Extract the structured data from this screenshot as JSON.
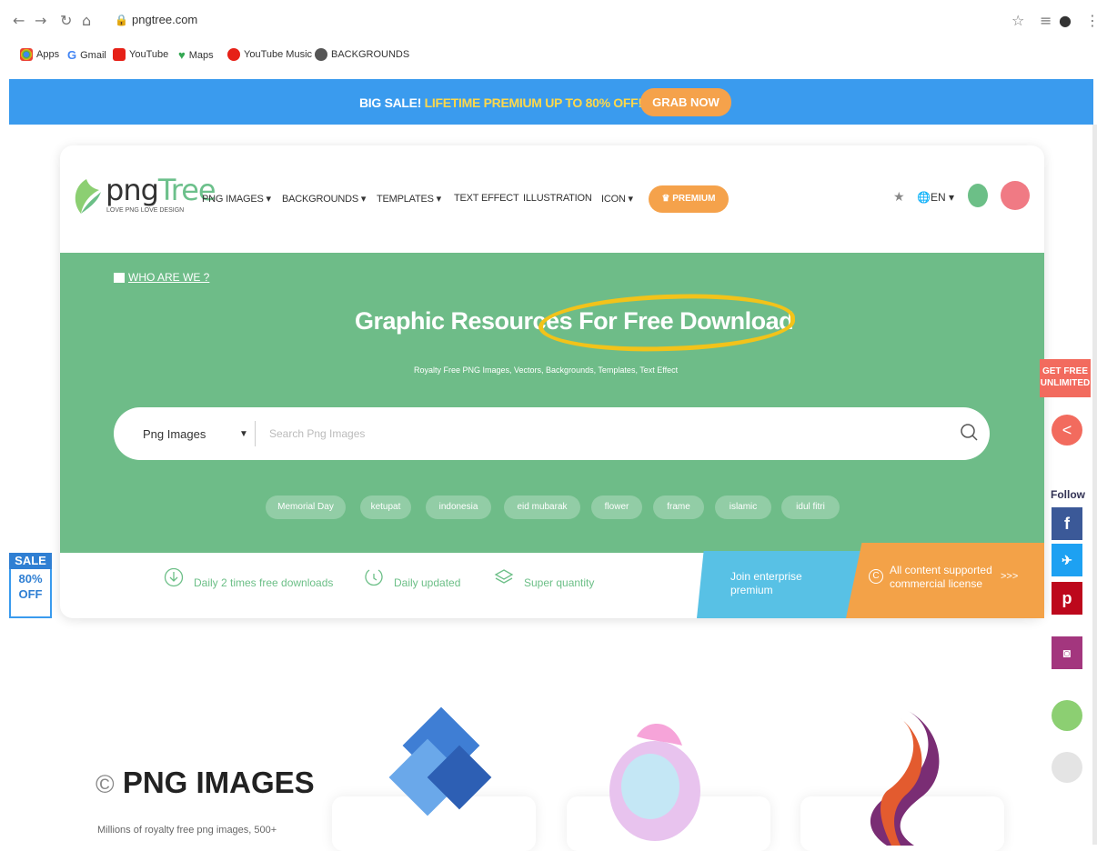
{
  "browser": {
    "url": "pngtree.com",
    "bookmarks": [
      "Apps",
      "Gmail",
      "YouTube",
      "Maps",
      "YouTube Music",
      "BACKGROUNDS"
    ]
  },
  "promo": {
    "text_white": "BIG SALE! ",
    "text_yellow": "LIFETIME PREMIUM UP TO 80% OFF!",
    "button": "GRAB NOW"
  },
  "header": {
    "logo_left": "png",
    "logo_right": "Tree",
    "tagline": "LOVE PNG LOVE DESIGN",
    "nav": [
      "PNG IMAGES ▾",
      "BACKGROUNDS ▾",
      "TEMPLATES ▾",
      "TEXT EFFECT",
      "ILLUSTRATION",
      "ICON ▾"
    ],
    "premium": "PREMIUM",
    "language": "EN ▾"
  },
  "hero": {
    "who": "WHO ARE WE ?",
    "headline": "Graphic Resources For Free Download",
    "subtitle": "Royalty Free PNG Images, Vectors, Backgrounds, Templates, Text Effect",
    "search_type": "Png Images",
    "search_placeholder": "Search Png Images",
    "tags": [
      "Memorial Day",
      "ketupat",
      "indonesia",
      "eid mubarak",
      "flower",
      "frame",
      "islamic",
      "idul fitri"
    ]
  },
  "features": {
    "daily_downloads": "Daily 2 times free downloads",
    "daily_updated": "Daily updated",
    "super_quantity": "Super quantity",
    "enterprise": "Join enterprise premium",
    "license": "All content supported commercial license"
  },
  "sale_badge": {
    "line1": "SALE",
    "line2": "80%",
    "line3": "OFF"
  },
  "sidebar": {
    "get_free": "GET FREE UNLIMITED",
    "follow": "Follow",
    "social": [
      {
        "name": "facebook",
        "glyph": "f",
        "color": "#3b5998"
      },
      {
        "name": "twitter",
        "glyph": "🐦",
        "color": "#1da1f2"
      },
      {
        "name": "pinterest",
        "glyph": "P",
        "color": "#bd081c"
      },
      {
        "name": "instagram",
        "glyph": "◙",
        "color": "#8a3ab9"
      }
    ]
  },
  "section": {
    "title": "PNG IMAGES",
    "description": "Millions of royalty free png images, 500+"
  }
}
